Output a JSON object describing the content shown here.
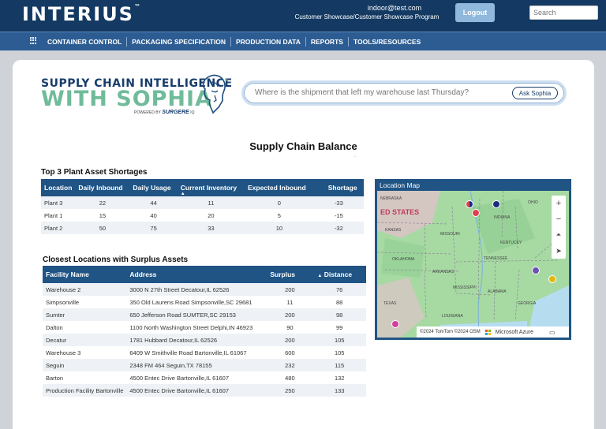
{
  "header": {
    "logo": "INTERIUS",
    "logo_tm": "™",
    "user_email": "indoor@test.com",
    "user_program": "Customer Showcase/Customer Showcase Program",
    "logout_label": "Logout",
    "search_placeholder": "Search"
  },
  "nav": {
    "items": [
      "CONTAINER CONTROL",
      "PACKAGING SPECIFICATION",
      "PRODUCTION DATA",
      "REPORTS",
      "TOOLS/RESOURCES"
    ]
  },
  "brand": {
    "line1": "SUPPLY CHAIN INTELLIGENCE",
    "line2": "WITH SOPHIA",
    "powered_by": "POWERED BY",
    "powered_brand": "SURGERE",
    "powered_suffix": "IQ"
  },
  "ask": {
    "placeholder": "Where is the shipment that left my warehouse last Thursday?",
    "button": "Ask Sophia"
  },
  "page_title": "Supply Chain Balance",
  "shortages": {
    "title": "Top 3 Plant Asset Shortages",
    "columns": [
      "Location",
      "Daily Inbound",
      "Daily Usage",
      "Current Inventory",
      "Expected Inbound",
      "Shortage"
    ],
    "rows": [
      [
        "Plant 3",
        "22",
        "44",
        "11",
        "0",
        "-33"
      ],
      [
        "Plant 1",
        "15",
        "40",
        "20",
        "5",
        "-15"
      ],
      [
        "Plant 2",
        "50",
        "75",
        "33",
        "10",
        "-32"
      ]
    ]
  },
  "surplus": {
    "title": "Closest Locations with Surplus Assets",
    "columns": [
      "Facility Name",
      "Address",
      "Surplus",
      "Distance"
    ],
    "rows": [
      [
        "Warehouse 2",
        "3000 N 27th Street Decatour,IL 62526",
        "200",
        "76"
      ],
      [
        "Simpsonville",
        "350 Old Laurens Road Simpsonville,SC 29681",
        "11",
        "88"
      ],
      [
        "Sumter",
        "650 Jefferson Road SUMTER,SC 29153",
        "200",
        "98"
      ],
      [
        "Dalton",
        "1100 North Washington Street Delphi,IN 46923",
        "90",
        "99"
      ],
      [
        "Decatur",
        "1781 Hubbard Decatour,IL 62526",
        "200",
        "105"
      ],
      [
        "Warehouse 3",
        "6409 W Smithville Road Bartonville,IL 61067",
        "600",
        "105"
      ],
      [
        "Seguin",
        "2348 FM 464 Seguin,TX 78155",
        "232",
        "115"
      ],
      [
        "Barton",
        "4500 Entec Drive Bartonville,IL 61607",
        "480",
        "132"
      ],
      [
        "Production Facility Bartonville",
        "4500 Entec Drive Bartonville,IL 61607",
        "250",
        "133"
      ]
    ]
  },
  "map": {
    "title": "Location Map",
    "labels": {
      "country": "ED STATES",
      "nebraska": "NEBRASKA",
      "kansas": "KANSAS",
      "missouri": "MISSOURI",
      "indiana": "INDIANA",
      "ohio": "OHIO",
      "kentucky": "KENTUCKY",
      "oklahoma": "OKLAHOMA",
      "arkansas": "ARKANSAS",
      "tennessee": "TENNESSEE",
      "mississippi": "MISSISSIPPI",
      "alabama": "ALABAMA",
      "georgia": "GEORGIA",
      "texas": "TEXAS",
      "louisiana": "LOUISIANA"
    },
    "copyright": "©2024 TomTom ©2024 OSM",
    "provider": "Microsoft Azure",
    "zoom_in": "+",
    "zoom_out": "−",
    "colors": {
      "red": "#e0404e",
      "navy": "#1c2d80",
      "purple": "#6e4fb3",
      "yellow": "#e2b70d",
      "magenta": "#d43f9a"
    }
  }
}
